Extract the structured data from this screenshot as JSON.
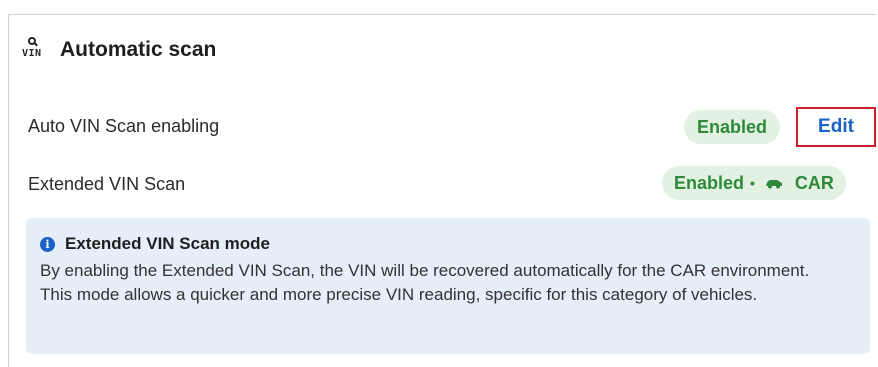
{
  "section": {
    "icon": "vin-search-icon",
    "icon_text": "VIN",
    "title": "Automatic scan"
  },
  "rows": [
    {
      "label": "Auto VIN Scan enabling",
      "status": "Enabled",
      "action": "Edit"
    },
    {
      "label": "Extended VIN Scan",
      "status": "Enabled",
      "separator": "•",
      "vehicle_icon": "car-icon",
      "vehicle": "CAR"
    }
  ],
  "info": {
    "icon": "info-icon",
    "title": "Extended VIN Scan mode",
    "body": "By enabling the Extended VIN Scan, the VIN will be recovered automatically for the CAR environment. This mode allows a quicker and more precise VIN reading, specific for this category of vehicles."
  },
  "colors": {
    "badge_bg": "#e3f1e2",
    "badge_text": "#2e8a3a",
    "link": "#1a62c6",
    "highlight_border": "#c8242c",
    "info_bg": "#e5eef9"
  }
}
